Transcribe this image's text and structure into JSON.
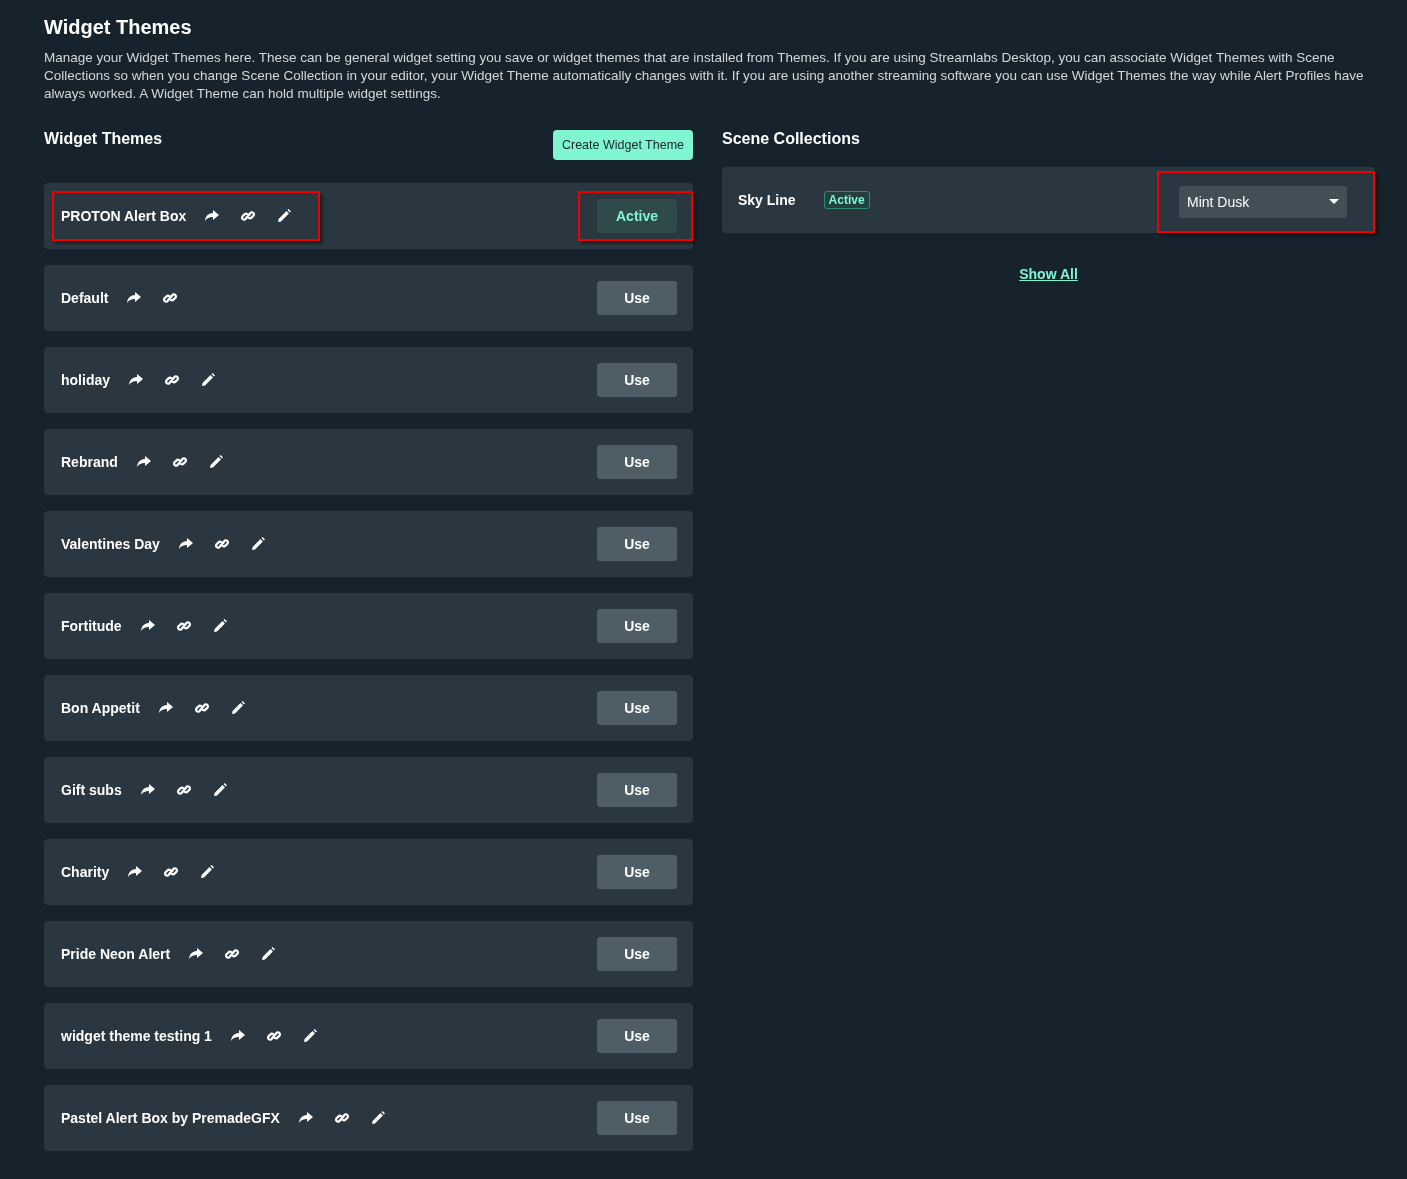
{
  "title": "Widget Themes",
  "description": "Manage your Widget Themes here. These can be general widget setting you save or widget themes that are installed from Themes. If you are using Streamlabs Desktop, you can associate Widget Themes with Scene Collections so when you change Scene Collection in your editor, your Widget Theme automatically changes with it. If you are using another streaming software you can use Widget Themes the way while Alert Profiles have always worked. A Widget Theme can hold multiple widget settings.",
  "themes_panel": {
    "heading": "Widget Themes",
    "create_button": "Create Widget Theme",
    "themes": [
      {
        "name": "PROTON Alert Box",
        "editable": true,
        "active": true,
        "button": "Active",
        "highlighted": true
      },
      {
        "name": "Default",
        "editable": false,
        "active": false,
        "button": "Use",
        "highlighted": false
      },
      {
        "name": "holiday",
        "editable": true,
        "active": false,
        "button": "Use",
        "highlighted": false
      },
      {
        "name": "Rebrand",
        "editable": true,
        "active": false,
        "button": "Use",
        "highlighted": false
      },
      {
        "name": "Valentines Day",
        "editable": true,
        "active": false,
        "button": "Use",
        "highlighted": false
      },
      {
        "name": "Fortitude",
        "editable": true,
        "active": false,
        "button": "Use",
        "highlighted": false
      },
      {
        "name": "Bon Appetit",
        "editable": true,
        "active": false,
        "button": "Use",
        "highlighted": false
      },
      {
        "name": "Gift subs",
        "editable": true,
        "active": false,
        "button": "Use",
        "highlighted": false
      },
      {
        "name": "Charity",
        "editable": true,
        "active": false,
        "button": "Use",
        "highlighted": false
      },
      {
        "name": "Pride Neon Alert",
        "editable": true,
        "active": false,
        "button": "Use",
        "highlighted": false
      },
      {
        "name": "widget theme testing 1",
        "editable": true,
        "active": false,
        "button": "Use",
        "highlighted": false
      },
      {
        "name": "Pastel Alert Box by PremadeGFX",
        "editable": true,
        "active": false,
        "button": "Use",
        "highlighted": false
      }
    ]
  },
  "scene_panel": {
    "heading": "Scene Collections",
    "collections": [
      {
        "name": "Sky Line",
        "badge": "Active",
        "theme": "Mint Dusk",
        "highlighted": true
      }
    ],
    "show_all": "Show All"
  }
}
